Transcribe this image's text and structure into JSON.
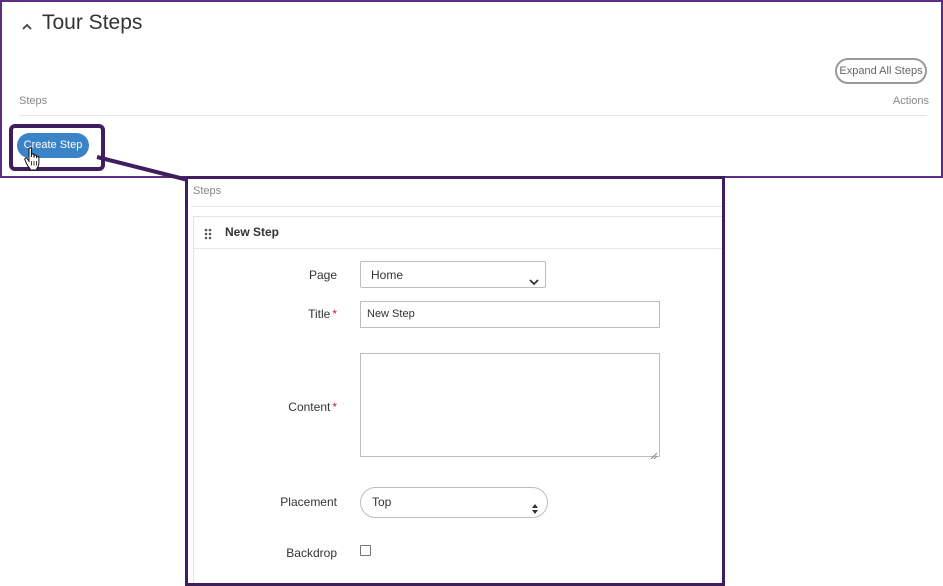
{
  "header": {
    "title": "Tour Steps",
    "expand_all_label": "Expand All Steps",
    "col_steps": "Steps",
    "col_actions": "Actions",
    "create_step_label": "Create Step"
  },
  "step_panel": {
    "steps_label": "Steps",
    "step_title": "New Step",
    "form": {
      "page_label": "Page",
      "page_value": "Home",
      "title_label": "Title",
      "title_value": "New Step",
      "content_label": "Content",
      "content_value": "",
      "placement_label": "Placement",
      "placement_value": "Top",
      "backdrop_label": "Backdrop",
      "backdrop_checked": false,
      "required_marker": "*"
    }
  },
  "colors": {
    "highlight_border": "#3e1e5e",
    "panel_border": "#5c2d82",
    "primary_button": "#3a83c6",
    "required": "#c0262d"
  },
  "icons": [
    "chevron-up-icon",
    "hand-cursor-icon",
    "drag-handle-icon",
    "chevron-down-icon",
    "updown-arrows-icon",
    "resize-grip-icon"
  ]
}
